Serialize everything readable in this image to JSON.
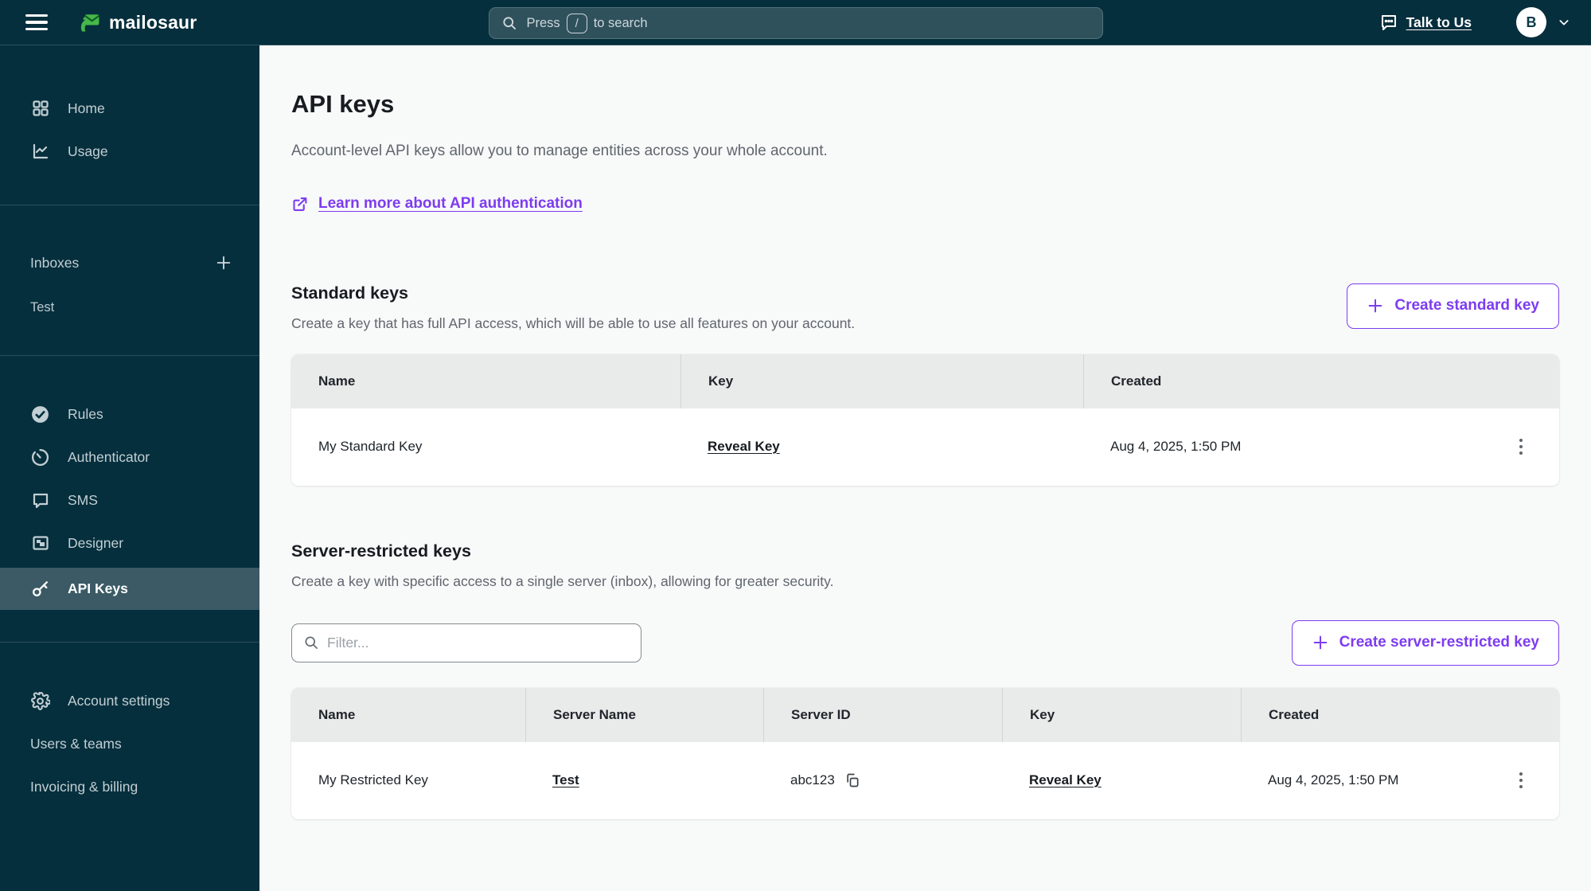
{
  "topbar": {
    "logo_text": "mailosaur",
    "search_prefix": "Press",
    "search_key": "/",
    "search_suffix": "to search",
    "talk_to_us": "Talk to Us",
    "avatar_initial": "B"
  },
  "sidebar": {
    "primary": [
      {
        "label": "Home",
        "icon": "grid-icon"
      },
      {
        "label": "Usage",
        "icon": "chart-icon"
      }
    ],
    "inboxes_label": "Inboxes",
    "inbox_items": [
      {
        "label": "Test"
      }
    ],
    "tools": [
      {
        "label": "Rules",
        "icon": "check-circle-icon",
        "active": false
      },
      {
        "label": "Authenticator",
        "icon": "timer-icon",
        "active": false
      },
      {
        "label": "SMS",
        "icon": "chat-bubble-icon",
        "active": false
      },
      {
        "label": "Designer",
        "icon": "image-icon",
        "active": false
      },
      {
        "label": "API Keys",
        "icon": "key-icon",
        "active": true
      }
    ],
    "account": [
      {
        "label": "Account settings",
        "icon": "gear-icon"
      },
      {
        "label": "Users & teams"
      },
      {
        "label": "Invoicing & billing"
      }
    ]
  },
  "page": {
    "title": "API keys",
    "subtitle": "Account-level API keys allow you to manage entities across your whole account.",
    "learn_more_label": "Learn more about API authentication"
  },
  "standard_keys": {
    "heading": "Standard keys",
    "description": "Create a key that has full API access, which will be able to use all features on your account.",
    "create_button": "Create standard key",
    "columns": {
      "name": "Name",
      "key": "Key",
      "created": "Created"
    },
    "rows": [
      {
        "name": "My Standard Key",
        "key_link": "Reveal Key",
        "created": "Aug 4, 2025, 1:50 PM"
      }
    ]
  },
  "server_keys": {
    "heading": "Server-restricted keys",
    "description": "Create a key with specific access to a single server (inbox), allowing for greater security.",
    "filter_placeholder": "Filter...",
    "create_button": "Create server-restricted key",
    "columns": {
      "name": "Name",
      "server_name": "Server Name",
      "server_id": "Server ID",
      "key": "Key",
      "created": "Created"
    },
    "rows": [
      {
        "name": "My Restricted Key",
        "server_name": "Test",
        "server_id": "abc123",
        "key_link": "Reveal Key",
        "created": "Aug 4, 2025, 1:50 PM"
      }
    ]
  },
  "colors": {
    "topbar_bg": "#062f3d",
    "sidebar_active_bg": "#3b5a65",
    "accent_purple": "#7d3cf0",
    "table_header_bg": "#e9eaea",
    "page_bg": "#f8f9f9",
    "logo_green": "#46b749"
  }
}
